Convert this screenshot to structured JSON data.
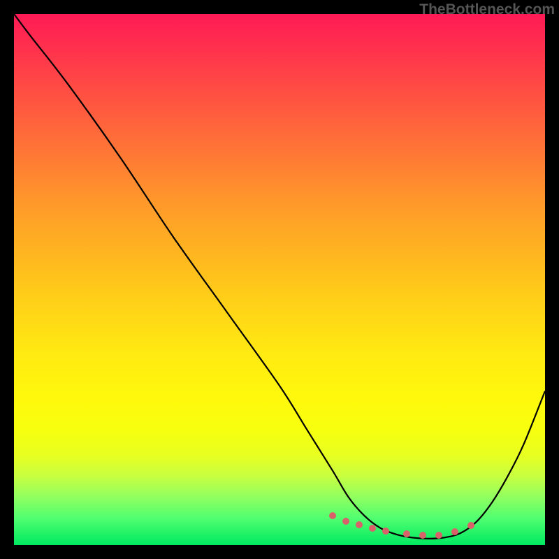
{
  "watermark": "TheBottleneck.com",
  "chart_data": {
    "type": "line",
    "title": "",
    "xlabel": "",
    "ylabel": "",
    "xlim": [
      0,
      100
    ],
    "ylim": [
      0,
      100
    ],
    "series": [
      {
        "name": "curve",
        "x": [
          0,
          3,
          10,
          20,
          30,
          40,
          50,
          55,
          60,
          63,
          66,
          69,
          72,
          75,
          78,
          81,
          84,
          87,
          90,
          93,
          96,
          100
        ],
        "y": [
          100,
          96,
          87,
          73,
          58,
          44,
          30,
          22,
          14,
          9,
          5.5,
          3.2,
          2.0,
          1.4,
          1.2,
          1.4,
          2.2,
          4.3,
          8.0,
          13,
          19,
          29
        ]
      }
    ],
    "markers": {
      "name": "bottom-dots",
      "color": "#d9626a",
      "points_x": [
        60,
        62.5,
        65,
        67.5,
        70,
        74,
        77,
        80,
        83,
        86
      ],
      "points_y": [
        5.5,
        4.5,
        3.8,
        3.2,
        2.6,
        2.1,
        1.8,
        1.9,
        2.5,
        3.7
      ]
    },
    "gradient_stops": [
      {
        "pct": 0,
        "color": "#ff1a55"
      },
      {
        "pct": 50,
        "color": "#ffc81a"
      },
      {
        "pct": 80,
        "color": "#ffff0c"
      },
      {
        "pct": 100,
        "color": "#00e860"
      }
    ]
  }
}
